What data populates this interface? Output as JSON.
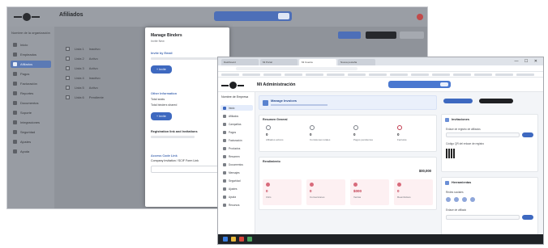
{
  "back": {
    "app_title": "Afiliados",
    "org": "Nombre de la organización",
    "nav": [
      "Inicio",
      "Empleados",
      "Afiliados",
      "Pagos",
      "Facturación",
      "Reportes",
      "Documentos",
      "Soporte",
      "Integraciones",
      "Seguridad",
      "Ajustes",
      "Ayuda"
    ],
    "rows": [
      [
        "Lista 1",
        "Inactivo"
      ],
      [
        "Lista 2",
        "Activo"
      ],
      [
        "Lista 3",
        "Activo"
      ],
      [
        "Lista 4",
        "Inactivo"
      ],
      [
        "Lista 5",
        "Activo"
      ],
      [
        "Lista 6",
        "Pendiente"
      ]
    ],
    "modal": {
      "title": "Manage Binders",
      "subtitle": "Invite New",
      "section1": "Invite by Email",
      "button1": "+ Invite",
      "section2": "Other Information",
      "kv": [
        [
          "Total seats",
          "0/5"
        ],
        [
          "Total binders shared",
          "2"
        ]
      ],
      "button2": "+ Invite",
      "section3": "Registration link and Invitations",
      "section4": "Access Code Link",
      "code_label": "Company Invitation / SCIF Form Link"
    }
  },
  "front": {
    "tabs": [
      "Dashboard",
      "Mi Portal",
      "Mi Cuenta",
      "Nueva pestaña"
    ],
    "window_controls": "— ☐ ✕",
    "title": "Mi Administración",
    "org": "Nombre de Empresa",
    "nav": [
      "Inicio",
      "Afiliados",
      "Campañas",
      "Pagos",
      "Facturación",
      "Productos",
      "Resumen",
      "Documentos",
      "Mensajes",
      "Seguridad",
      "Ajustes",
      "Ayuda",
      "Recursos"
    ],
    "banner_title": "Manage Invoices",
    "summary_title": "Resumen General",
    "stats": [
      {
        "value": "0",
        "label": "Afiliados activos"
      },
      {
        "value": "0",
        "label": "Comisiones totales"
      },
      {
        "value": "0",
        "label": "Pagos pendientes"
      },
      {
        "value": "0",
        "label": "Facturas"
      }
    ],
    "perf_title": "Rendimiento",
    "perf_amount": "$00,000",
    "kpis": [
      {
        "value": "0",
        "label": "Clics"
      },
      {
        "value": "0",
        "label": "Conversiones"
      },
      {
        "value": "$000",
        "label": "Ventas"
      },
      {
        "value": "0",
        "label": "Reembolsos"
      }
    ],
    "right": {
      "panel1_title": "Invitaciones",
      "panel1_label": "Enlace de registro de afiliados",
      "panel1_label2": "Código QR del enlace de registro",
      "panel2_title": "Herramientas",
      "panel2_label": "Redes sociales",
      "panel2_label2": "Enlace de afiliado"
    }
  },
  "colors": {
    "accent": "#3e69c0",
    "dark": "#1f2023",
    "danger": "#c23a4e"
  }
}
